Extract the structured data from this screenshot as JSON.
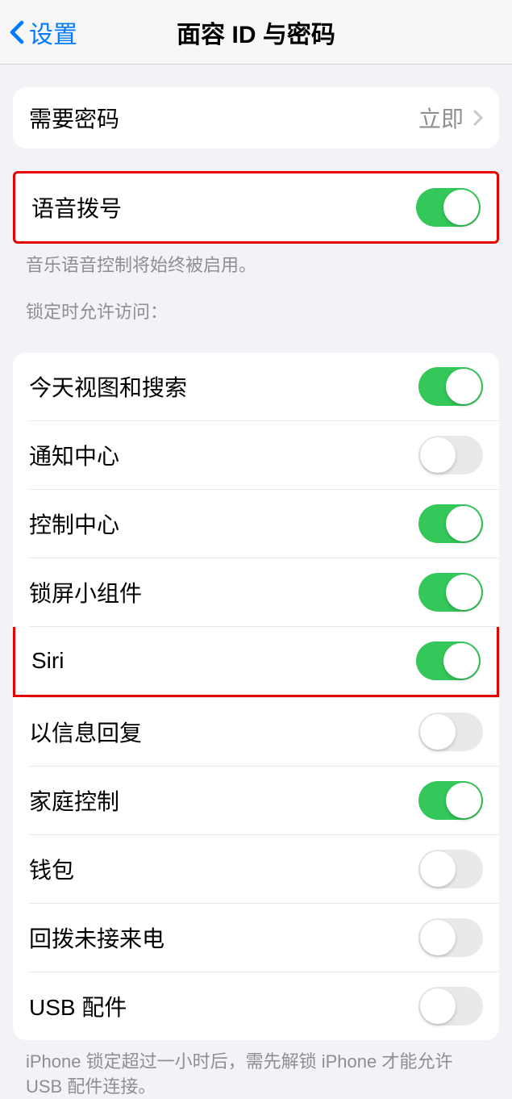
{
  "nav": {
    "back_label": "设置",
    "title": "面容 ID 与密码"
  },
  "require_passcode": {
    "label": "需要密码",
    "value": "立即"
  },
  "voice_dial": {
    "label": "语音拨号",
    "footer": "音乐语音控制将始终被启用。"
  },
  "allow_access_header": "锁定时允许访问：",
  "access_items": [
    {
      "label": "今天视图和搜索",
      "on": true
    },
    {
      "label": "通知中心",
      "on": false
    },
    {
      "label": "控制中心",
      "on": true
    },
    {
      "label": "锁屏小组件",
      "on": true
    },
    {
      "label": "Siri",
      "on": true
    },
    {
      "label": "以信息回复",
      "on": false
    },
    {
      "label": "家庭控制",
      "on": true
    },
    {
      "label": "钱包",
      "on": false
    },
    {
      "label": "回拨未接来电",
      "on": false
    },
    {
      "label": "USB 配件",
      "on": false
    }
  ],
  "usb_footer": "iPhone 锁定超过一小时后，需先解锁 iPhone 才能允许USB 配件连接。"
}
